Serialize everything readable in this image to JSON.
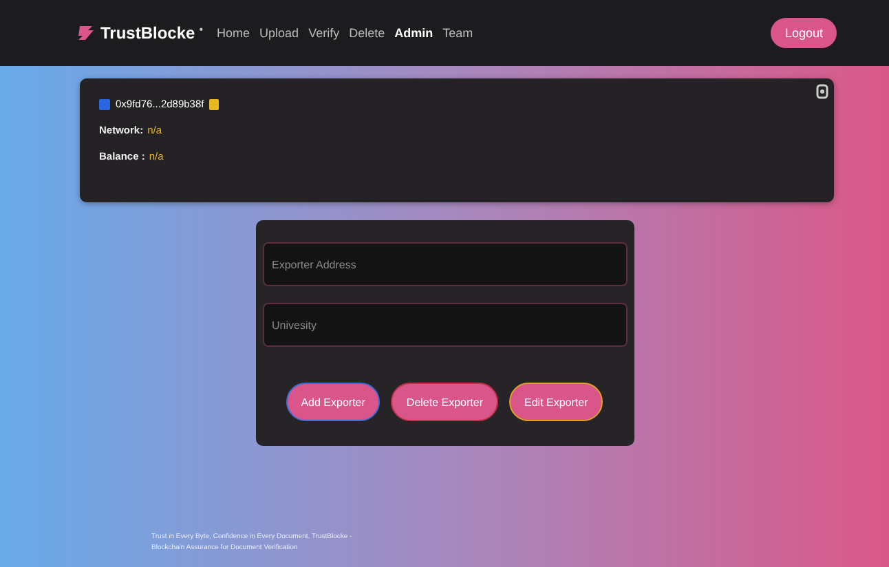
{
  "navbar": {
    "brand": "TrustBlocke",
    "brand_mark": "•",
    "links": [
      {
        "label": "Home",
        "selected": false
      },
      {
        "label": "Upload",
        "selected": false
      },
      {
        "label": "Verify",
        "selected": false
      },
      {
        "label": "Delete",
        "selected": false
      },
      {
        "label": "Admin",
        "selected": true
      },
      {
        "label": "Team",
        "selected": false
      }
    ],
    "logout": "Logout"
  },
  "account": {
    "address": "0x9fd76...2d89b38f",
    "network_label": "Network:",
    "network": "n/a",
    "balance_label": "Balance :",
    "balance": "n/a"
  },
  "form": {
    "fields": [
      {
        "placeholder": "Exporter Address"
      },
      {
        "placeholder": "Univesity"
      }
    ],
    "buttons": [
      {
        "label": "Add Exporter",
        "color": "#3b6fd8"
      },
      {
        "label": "Delete Exporter",
        "color": "#c0304a"
      },
      {
        "label": "Edit Exporter",
        "color": "#e0a020"
      }
    ]
  },
  "footer": "Trust in Every Byte, Confidence in Every Document. TrustBlocke - Blockchain Assurance for Document Verification"
}
